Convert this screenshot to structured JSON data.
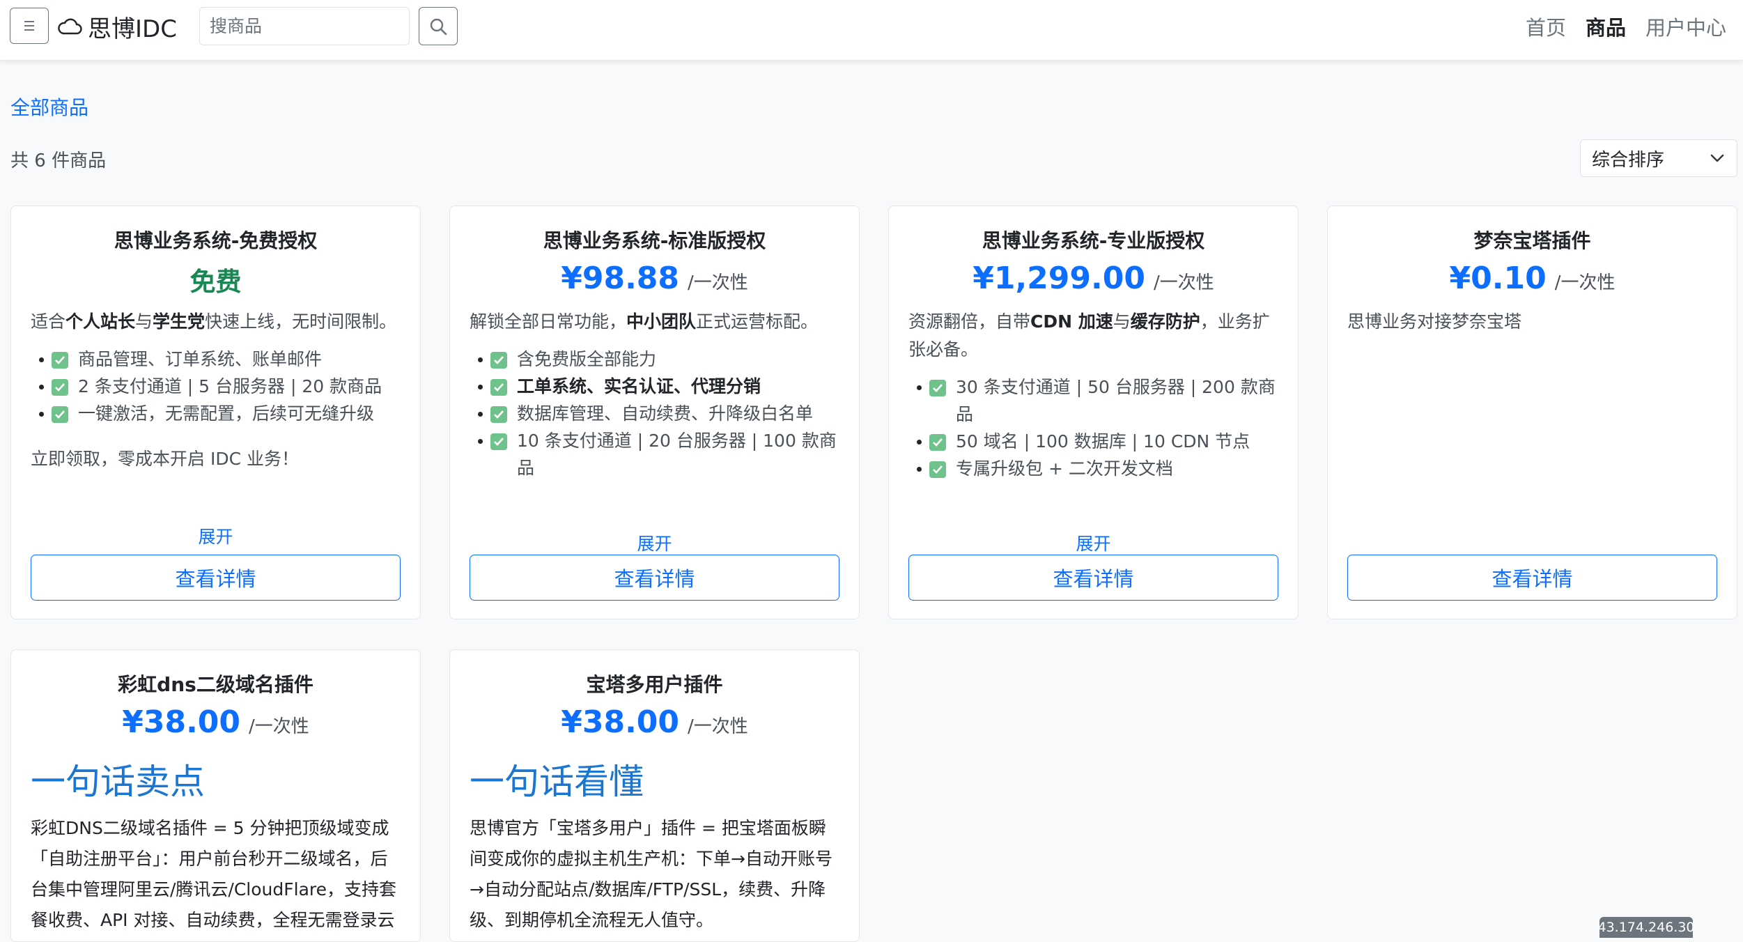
{
  "navbar": {
    "brand": "思博IDC",
    "search_placeholder": "搜商品",
    "links": [
      {
        "label": "首页",
        "active": false
      },
      {
        "label": "商品",
        "active": true
      },
      {
        "label": "用户中心",
        "active": false
      }
    ]
  },
  "breadcrumb": "全部商品",
  "count_text": "共 6 件商品",
  "sort": {
    "selected": "综合排序"
  },
  "colors": {
    "primary": "#0d6efd",
    "free": "#198754",
    "headline": "#1976d2"
  },
  "cards": [
    {
      "title": "思博业务系统-免费授权",
      "price": "免费",
      "desc_parts": [
        "适合",
        "个人站长",
        "与",
        "学生党",
        "快速上线，无时间限制。"
      ],
      "features": [
        "商品管理、订单系统、账单邮件",
        "2 条支付通道 | 5 台服务器 | 20 款商品",
        "一键激活，无需配置，后续可无缝升级"
      ],
      "outro": "立即领取，零成本开启 IDC 业务！",
      "expand": "展开",
      "button": "查看详情"
    },
    {
      "title": "思博业务系统-标准版授权",
      "price": "¥98.88",
      "unit": "/一次性",
      "desc_parts": [
        "解锁全部日常功能，",
        "中小团队",
        "正式运营标配。"
      ],
      "features": [
        "含免费版全部能力",
        "工单系统、实名认证、代理分销",
        "数据库管理、自动续费、升降级白名单",
        "10 条支付通道 | 20 台服务器 | 100 款商品"
      ],
      "expand": "展开",
      "button": "查看详情"
    },
    {
      "title": "思博业务系统-专业版授权",
      "price": "¥1,299.00",
      "unit": "/一次性",
      "desc_parts": [
        "资源翻倍，自带",
        "CDN 加速",
        "与",
        "缓存防护",
        "，业务扩张必备。"
      ],
      "features": [
        "30 条支付通道 | 50 台服务器 | 200 款商品",
        "50 域名 | 100 数据库 | 10 CDN 节点",
        "专属升级包 + 二次开发文档"
      ],
      "expand": "展开",
      "button": "查看详情"
    },
    {
      "title": "梦奈宝塔插件",
      "price": "¥0.10",
      "unit": "/一次性",
      "desc": "思博业务对接梦奈宝塔",
      "button": "查看详情"
    },
    {
      "title": "彩虹dns二级域名插件",
      "price": "¥38.00",
      "unit": "/一次性",
      "headline": "一句话卖点",
      "long_desc": "彩虹DNS二级域名插件 = 5 分钟把顶级域变成「自助注册平台」：用户前台秒开二级域名，后台集中管理阿里云/腾讯云/CloudFlare，支持套餐收费、API 对接、自动续费，全程无需登录云"
    },
    {
      "title": "宝塔多用户插件",
      "price": "¥38.00",
      "unit": "/一次性",
      "headline": "一句话看懂",
      "long_desc": "思博官方「宝塔多用户」插件 = 把宝塔面板瞬间变成你的虚拟主机生产机：下单→自动开账号→自动分配站点/数据库/FTP/SSL，续费、升降级、到期停机全流程无人值守。"
    }
  ],
  "ip_badge": "43.174.246.30"
}
